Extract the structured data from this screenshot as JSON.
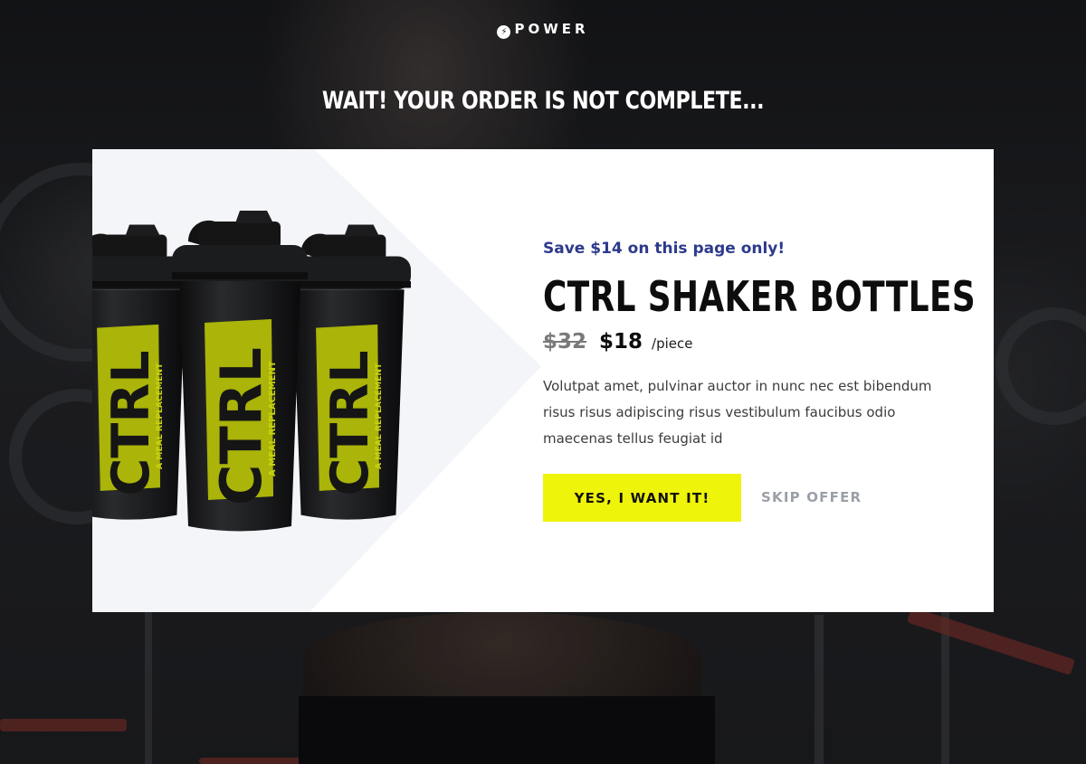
{
  "header": {
    "logo_text": "POWER",
    "headline": "WAIT! YOUR ORDER IS NOT COMPLETE..."
  },
  "offer": {
    "save_text": "Save $14 on this page only!",
    "title": "CTRL SHAKER BOTTLES",
    "old_price": "$32",
    "new_price": "$18",
    "unit": "/piece",
    "description": "Volutpat amet, pulvinar auctor in nunc nec est bibendum risus risus adipiscing risus vestibulum faucibus odio maecenas tellus feugiat id",
    "cta_label": "YES, I WANT IT!",
    "skip_label": "SKIP OFFER"
  },
  "product_image": {
    "brand": "CTRL",
    "tagline": "A MEAL REPLACEMENT",
    "count": 3
  },
  "colors": {
    "accent": "#eef40a",
    "save_text": "#2d3a8c",
    "skip": "#9aa0a6"
  }
}
